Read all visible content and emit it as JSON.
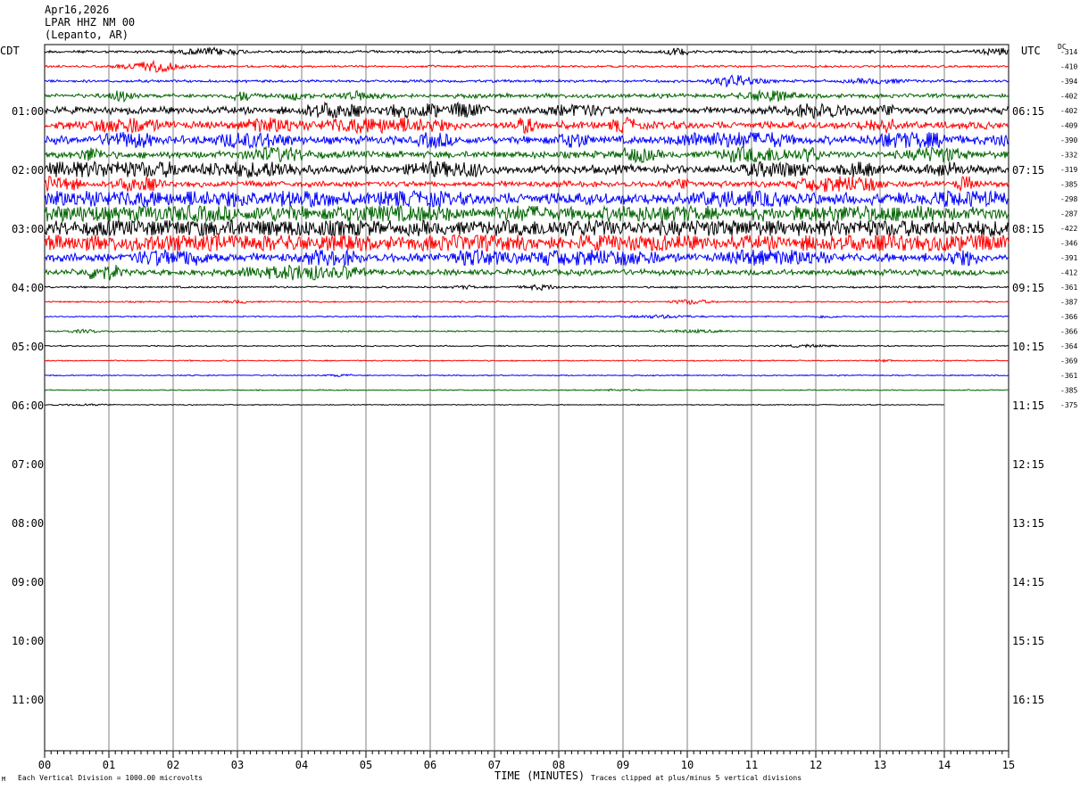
{
  "header": {
    "date": "Apr16,2026",
    "station": "LPAR HHZ NM 00",
    "location": "(Lepanto, AR)"
  },
  "left_tz": "CDT",
  "right_tz": "UTC",
  "dc_label": "DC",
  "xlabel": "TIME (MINUTES)",
  "footer_left": "Each Vertical Division = 1000.00 microvolts",
  "footer_right": "Traces clipped at plus/minus 5 vertical divisions",
  "corner_mark": "M",
  "colors": {
    "black": "#000000",
    "red": "#ff0000",
    "blue": "#0000ff",
    "green": "#006400",
    "grid": "#808080"
  },
  "chart_data": {
    "type": "line",
    "xlim": [
      0,
      15
    ],
    "x_tick_labels": [
      "00",
      "01",
      "02",
      "03",
      "04",
      "05",
      "06",
      "07",
      "08",
      "09",
      "10",
      "11",
      "12",
      "13",
      "14",
      "15"
    ],
    "left_time_labels": [
      "01:00",
      "02:00",
      "03:00",
      "04:00",
      "05:00",
      "06:00",
      "07:00",
      "08:00",
      "09:00",
      "10:00",
      "11:00"
    ],
    "right_time_labels": [
      "06:15",
      "07:15",
      "08:15",
      "09:15",
      "10:15",
      "11:15",
      "12:15",
      "13:15",
      "14:15",
      "15:15",
      "16:15"
    ],
    "trace_color_cycle": [
      "black",
      "red",
      "blue",
      "green"
    ],
    "dc_offsets": [
      -314,
      -410,
      -394,
      -402,
      -402,
      -409,
      -390,
      -332,
      -319,
      -385,
      -298,
      -287,
      -422,
      -346,
      -391,
      -412,
      -361,
      -387,
      -366,
      -366,
      -364,
      -369,
      -361,
      -385,
      -375
    ],
    "trace_activity": [
      1,
      0.8,
      1,
      1.6,
      2.6,
      2.8,
      3,
      2.6,
      3.2,
      2.2,
      4.5,
      5,
      6,
      5.5,
      3.2,
      2.2,
      0.7,
      0.6,
      0.5,
      0.5,
      0.45,
      0.45,
      0.45,
      0.4,
      0.35
    ],
    "last_trace_end_minute": 14
  }
}
